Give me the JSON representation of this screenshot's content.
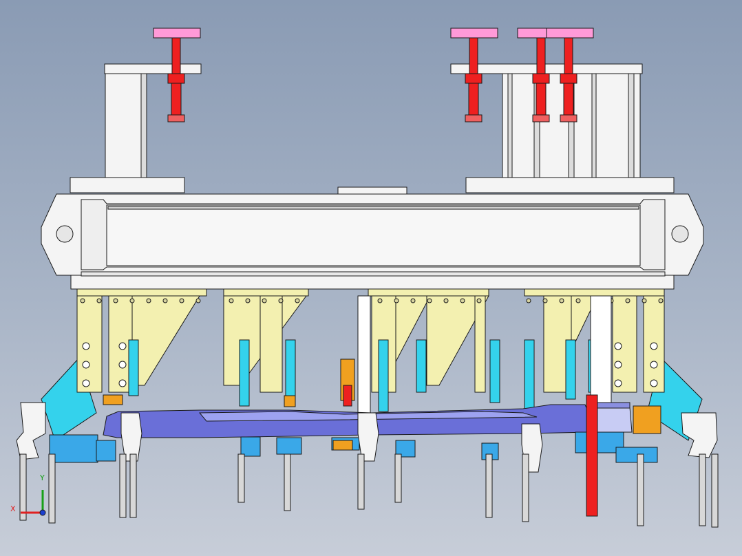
{
  "view": {
    "type": "3D CAD model view - fixture assembly, front view",
    "background_gradient": [
      "#8a9bb4",
      "#a9b5c7",
      "#c7cdd8"
    ]
  },
  "triad": {
    "x_label": "X",
    "y_label": "Y",
    "x_color": "#e02020",
    "y_color": "#18a018",
    "z_color": "#1a3fd0"
  },
  "colors": {
    "frame": "#f4f4f4",
    "edge": "#1a1a1a",
    "gusset": "#f3f0b0",
    "bolt_pad": "#ff9ad8",
    "bolt": "#ee2020",
    "cyan": "#34d2ec",
    "blue": "#3aa8e8",
    "part": "#6a6fd8",
    "part_light": "#9da2f0",
    "orange": "#f0a020",
    "pin": "#d8d8d8"
  }
}
